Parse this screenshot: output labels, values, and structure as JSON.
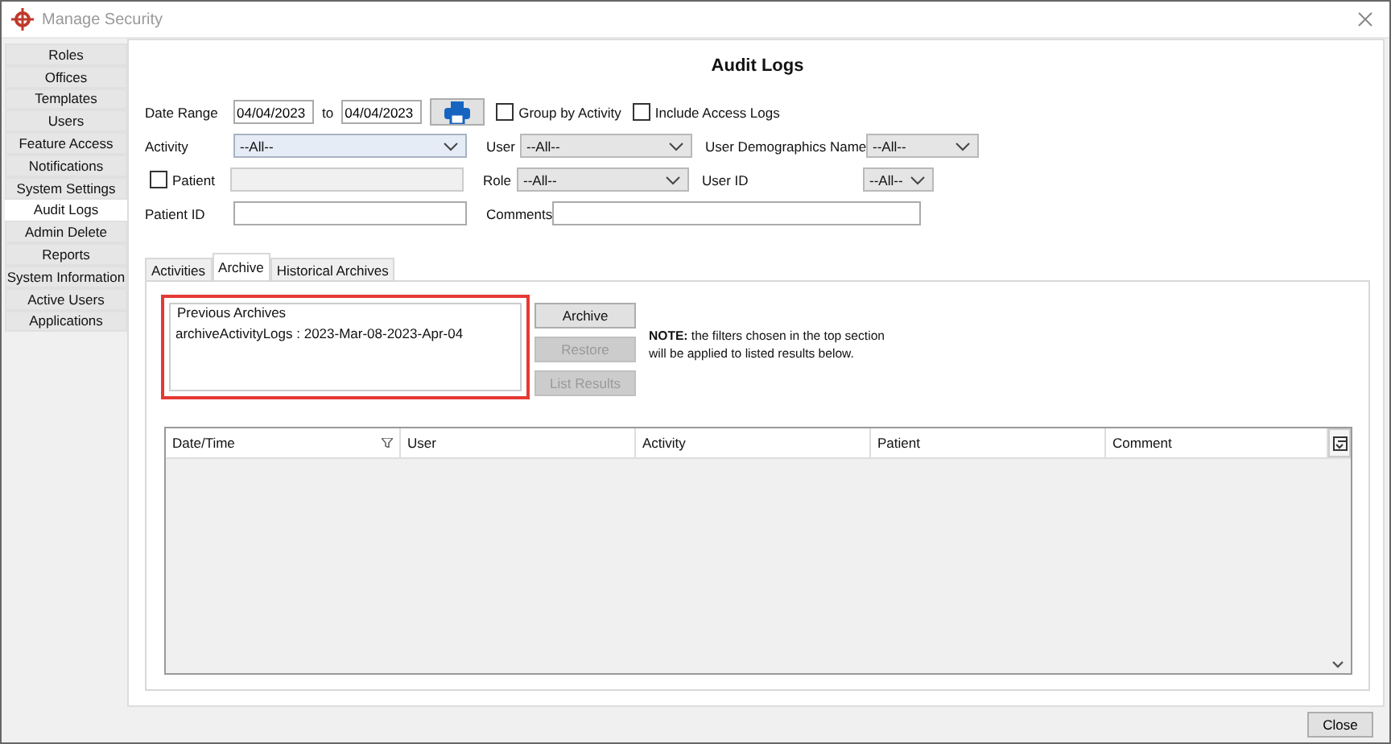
{
  "window": {
    "title": "Manage Security"
  },
  "sidebar": {
    "items": [
      {
        "label": "Roles",
        "selected": false
      },
      {
        "label": "Offices",
        "selected": false
      },
      {
        "label": "Templates",
        "selected": false
      },
      {
        "label": "Users",
        "selected": false
      },
      {
        "label": "Feature Access",
        "selected": false
      },
      {
        "label": "Notifications",
        "selected": false
      },
      {
        "label": "System Settings",
        "selected": false
      },
      {
        "label": "Audit Logs",
        "selected": true
      },
      {
        "label": "Admin Delete",
        "selected": false
      },
      {
        "label": "Reports",
        "selected": false
      },
      {
        "label": "System Information",
        "selected": false
      },
      {
        "label": "Active Users",
        "selected": false
      },
      {
        "label": "Applications",
        "selected": false
      }
    ]
  },
  "heading": "Audit Logs",
  "filters": {
    "date_range_label": "Date Range",
    "date_from": "04/04/2023",
    "to_label": "to",
    "date_to": "04/04/2023",
    "group_by_activity": {
      "label": "Group by Activity",
      "checked": false
    },
    "include_access_logs": {
      "label": "Include Access Logs",
      "checked": false
    },
    "activity": {
      "label": "Activity",
      "value": "--All--"
    },
    "user": {
      "label": "User",
      "value": "--All--"
    },
    "user_demographics_name": {
      "label": "User Demographics Name",
      "value": "--All--"
    },
    "patient": {
      "label": "Patient",
      "checked": false
    },
    "role": {
      "label": "Role",
      "value": "--All--"
    },
    "user_id": {
      "label": "User ID",
      "value": "--All--"
    },
    "patient_id": {
      "label": "Patient ID"
    },
    "comments": {
      "label": "Comments"
    }
  },
  "tabs": [
    {
      "label": "Activities",
      "selected": false
    },
    {
      "label": "Archive",
      "selected": true
    },
    {
      "label": "Historical Archives",
      "selected": false
    }
  ],
  "archive": {
    "group_title": "Previous Archives",
    "items": [
      "archiveActivityLogs : 2023-Mar-08-2023-Apr-04"
    ],
    "buttons": [
      {
        "label": "Archive",
        "disabled": false
      },
      {
        "label": "Restore",
        "disabled": true
      },
      {
        "label": "List Results",
        "disabled": true
      }
    ],
    "note": "**NOTE:** the filters chosen in the top section\nwill be applied to listed results below."
  },
  "table": {
    "columns": [
      "Date/Time",
      "User",
      "Activity",
      "Patient",
      "Comment"
    ]
  },
  "close_button": "Close"
}
